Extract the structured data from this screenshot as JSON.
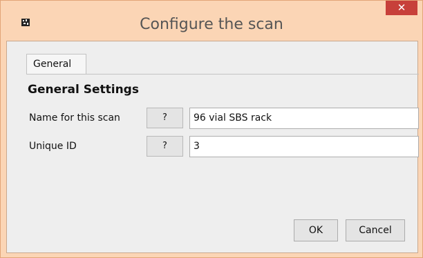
{
  "window": {
    "title": "Configure the scan",
    "close_symbol": "✕",
    "app_icon": "barcode-icon"
  },
  "tabs": [
    {
      "label": "General",
      "selected": true
    }
  ],
  "section": {
    "title": "General Settings"
  },
  "fields": [
    {
      "label": "Name for this scan",
      "help_label": "?",
      "value": "96 vial SBS rack"
    },
    {
      "label": "Unique ID",
      "help_label": "?",
      "value": "3"
    }
  ],
  "buttons": {
    "ok": "OK",
    "cancel": "Cancel"
  },
  "colors": {
    "title_bar": "#fbd5b5",
    "close_button": "#c7403a"
  }
}
